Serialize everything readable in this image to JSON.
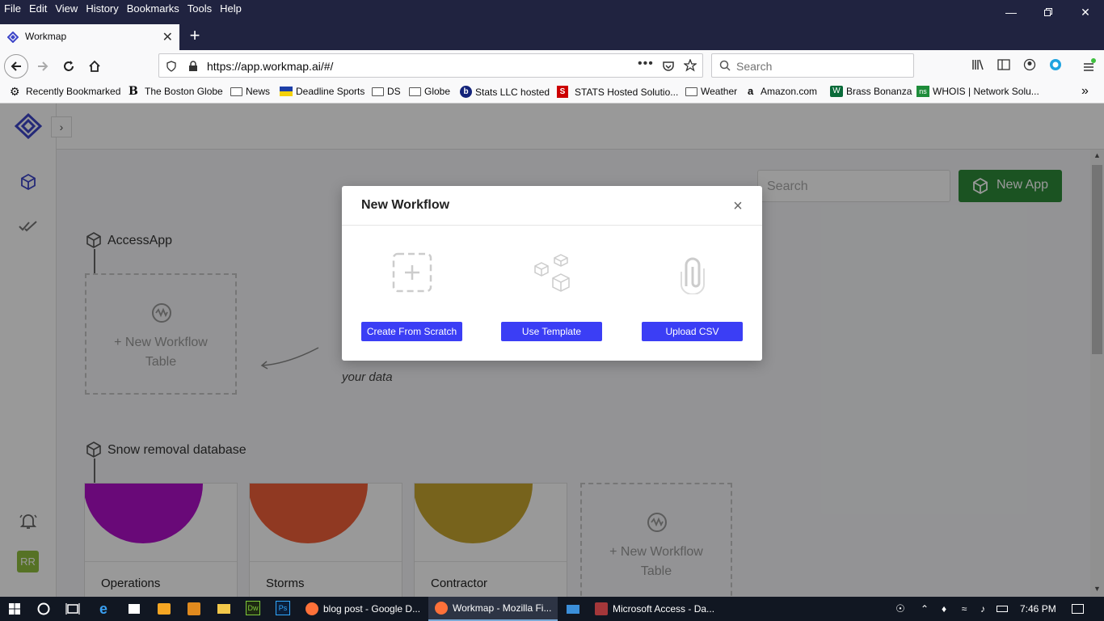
{
  "menubar": {
    "items": [
      "File",
      "Edit",
      "View",
      "History",
      "Bookmarks",
      "Tools",
      "Help"
    ]
  },
  "tab": {
    "title": "Workmap"
  },
  "navbar": {
    "url": "https://app.workmap.ai/#/",
    "search_placeholder": "Search"
  },
  "bookmarks": [
    {
      "label": "Recently Bookmarked",
      "icon": "gear-icon"
    },
    {
      "label": "The Boston Globe",
      "icon": "globe-logo-icon"
    },
    {
      "label": "News",
      "icon": "folder-icon"
    },
    {
      "label": "Deadline Sports",
      "icon": "flag-icon"
    },
    {
      "label": "DS",
      "icon": "folder-icon"
    },
    {
      "label": "Globe",
      "icon": "folder-icon"
    },
    {
      "label": "Stats LLC hosted",
      "icon": "b-icon"
    },
    {
      "label": "STATS Hosted Solutio...",
      "icon": "stats-icon"
    },
    {
      "label": "Weather",
      "icon": "folder-icon"
    },
    {
      "label": "Amazon.com",
      "icon": "amazon-icon"
    },
    {
      "label": "Brass Bonanza",
      "icon": "whalers-icon"
    },
    {
      "label": "WHOIS | Network Solu...",
      "icon": "ns-icon"
    }
  ],
  "app": {
    "search_placeholder": "Search",
    "new_app_label": "New App",
    "avatar_initials": "RR",
    "sections": [
      {
        "title": "AccessApp",
        "new_table_label": "+ New Workflow Table"
      },
      {
        "title": "Snow removal database",
        "new_table_label": "+ New Workflow Table"
      }
    ],
    "hint_text": "your data",
    "cards": [
      {
        "title": "Operations",
        "color": "#b010c8"
      },
      {
        "title": "Storms",
        "color": "#f0603a"
      },
      {
        "title": "Contractor",
        "color": "#c7a630"
      }
    ]
  },
  "modal": {
    "title": "New Workflow",
    "options": [
      {
        "label": "Create From Scratch",
        "icon": "plus-square-icon"
      },
      {
        "label": "Use Template",
        "icon": "cubes-icon"
      },
      {
        "label": "Upload CSV",
        "icon": "paperclip-icon"
      }
    ]
  },
  "taskbar": {
    "apps": [
      {
        "label": "blog post - Google D...",
        "icon": "firefox-icon"
      },
      {
        "label": "Workmap - Mozilla Fi...",
        "icon": "firefox-icon"
      },
      {
        "label": "Microsoft Access - Da...",
        "icon": "access-icon"
      }
    ],
    "clock": "7:46 PM"
  },
  "colors": {
    "accent_blue": "#3b3ef5",
    "new_app_green": "#2e8b3a",
    "brand_logo": "#3d45c8"
  }
}
